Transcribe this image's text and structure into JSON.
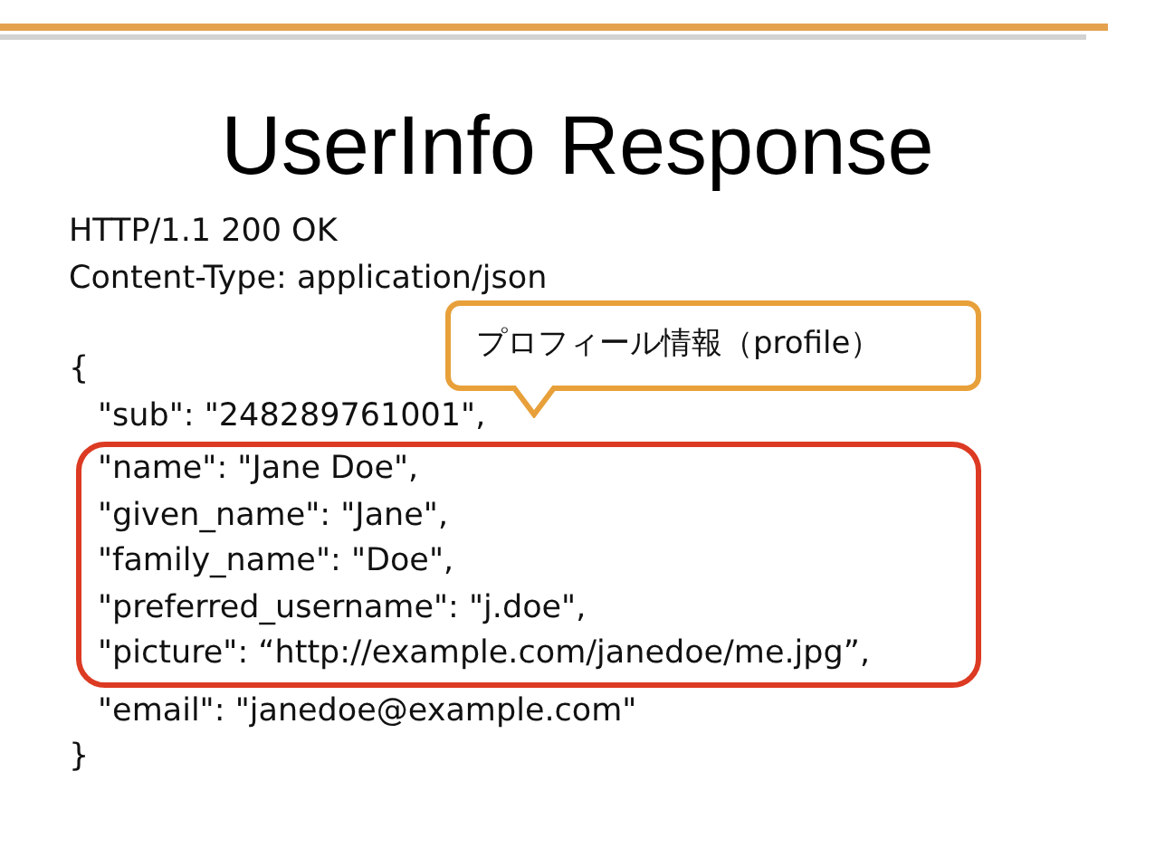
{
  "title": "UserInfo Response",
  "header_lines": [
    "HTTP/1.1 200 OK",
    "Content-Type: application/json"
  ],
  "code_lines": [
    {
      "kind": "brace",
      "text": "{",
      "highlighted": false
    },
    {
      "kind": "field",
      "text": "\"sub\": \"248289761001\",",
      "highlighted": false
    },
    {
      "kind": "field",
      "text": "\"name\": \"Jane Doe\",",
      "highlighted": true
    },
    {
      "kind": "field",
      "text": "\"given_name\": \"Jane\",",
      "highlighted": true
    },
    {
      "kind": "field",
      "text": "\"family_name\": \"Doe\",",
      "highlighted": true
    },
    {
      "kind": "field",
      "text": "\"preferred_username\": \"j.doe\",",
      "highlighted": true
    },
    {
      "kind": "field",
      "text": "\"picture\": “http://example.com/janedoe/me.jpg”,",
      "highlighted": true
    },
    {
      "kind": "field",
      "text": "\"email\": \"janedoe@example.com\"",
      "highlighted": false
    },
    {
      "kind": "brace",
      "text": "}",
      "highlighted": false
    }
  ],
  "callout": {
    "text": "プロフィール情報（profile）"
  }
}
